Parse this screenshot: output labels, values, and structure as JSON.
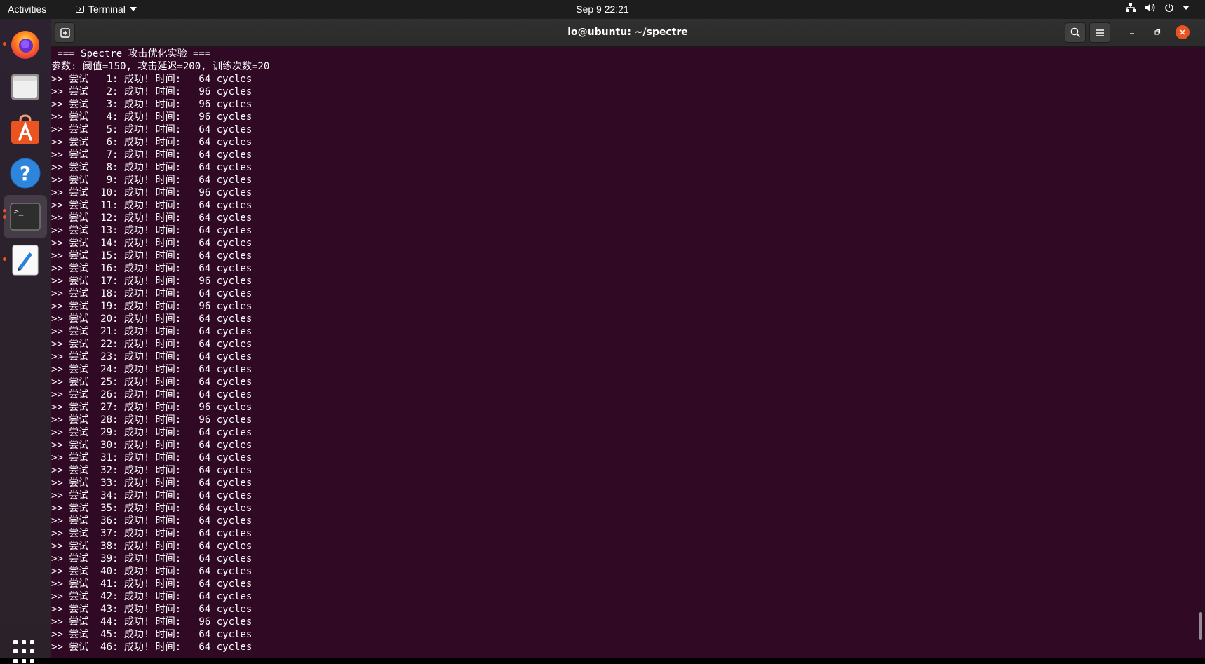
{
  "topbar": {
    "activities": "Activities",
    "app_name": "Terminal",
    "clock": "Sep 9  22:21"
  },
  "dock": {
    "apps": [
      "firefox",
      "files",
      "ubuntu-software",
      "help",
      "terminal",
      "text-editor"
    ]
  },
  "window": {
    "title": "lo@ubuntu: ~/spectre"
  },
  "terminal": {
    "lines": [
      " === Spectre 攻击优化实验 ===",
      "参数: 阈值=150, 攻击延迟=200, 训练次数=20",
      ">> 尝试   1: 成功! 时间:   64 cycles",
      ">> 尝试   2: 成功! 时间:   96 cycles",
      ">> 尝试   3: 成功! 时间:   96 cycles",
      ">> 尝试   4: 成功! 时间:   96 cycles",
      ">> 尝试   5: 成功! 时间:   64 cycles",
      ">> 尝试   6: 成功! 时间:   64 cycles",
      ">> 尝试   7: 成功! 时间:   64 cycles",
      ">> 尝试   8: 成功! 时间:   64 cycles",
      ">> 尝试   9: 成功! 时间:   64 cycles",
      ">> 尝试  10: 成功! 时间:   96 cycles",
      ">> 尝试  11: 成功! 时间:   64 cycles",
      ">> 尝试  12: 成功! 时间:   64 cycles",
      ">> 尝试  13: 成功! 时间:   64 cycles",
      ">> 尝试  14: 成功! 时间:   64 cycles",
      ">> 尝试  15: 成功! 时间:   64 cycles",
      ">> 尝试  16: 成功! 时间:   64 cycles",
      ">> 尝试  17: 成功! 时间:   96 cycles",
      ">> 尝试  18: 成功! 时间:   64 cycles",
      ">> 尝试  19: 成功! 时间:   96 cycles",
      ">> 尝试  20: 成功! 时间:   64 cycles",
      ">> 尝试  21: 成功! 时间:   64 cycles",
      ">> 尝试  22: 成功! 时间:   64 cycles",
      ">> 尝试  23: 成功! 时间:   64 cycles",
      ">> 尝试  24: 成功! 时间:   64 cycles",
      ">> 尝试  25: 成功! 时间:   64 cycles",
      ">> 尝试  26: 成功! 时间:   64 cycles",
      ">> 尝试  27: 成功! 时间:   96 cycles",
      ">> 尝试  28: 成功! 时间:   96 cycles",
      ">> 尝试  29: 成功! 时间:   64 cycles",
      ">> 尝试  30: 成功! 时间:   64 cycles",
      ">> 尝试  31: 成功! 时间:   64 cycles",
      ">> 尝试  32: 成功! 时间:   64 cycles",
      ">> 尝试  33: 成功! 时间:   64 cycles",
      ">> 尝试  34: 成功! 时间:   64 cycles",
      ">> 尝试  35: 成功! 时间:   64 cycles",
      ">> 尝试  36: 成功! 时间:   64 cycles",
      ">> 尝试  37: 成功! 时间:   64 cycles",
      ">> 尝试  38: 成功! 时间:   64 cycles",
      ">> 尝试  39: 成功! 时间:   64 cycles",
      ">> 尝试  40: 成功! 时间:   64 cycles",
      ">> 尝试  41: 成功! 时间:   64 cycles",
      ">> 尝试  42: 成功! 时间:   64 cycles",
      ">> 尝试  43: 成功! 时间:   64 cycles",
      ">> 尝试  44: 成功! 时间:   96 cycles",
      ">> 尝试  45: 成功! 时间:   64 cycles",
      ">> 尝试  46: 成功! 时间:   64 cycles"
    ]
  },
  "colors": {
    "terminal_bg": "#300a24",
    "terminal_fg": "#ffffff",
    "accent": "#e95420"
  }
}
